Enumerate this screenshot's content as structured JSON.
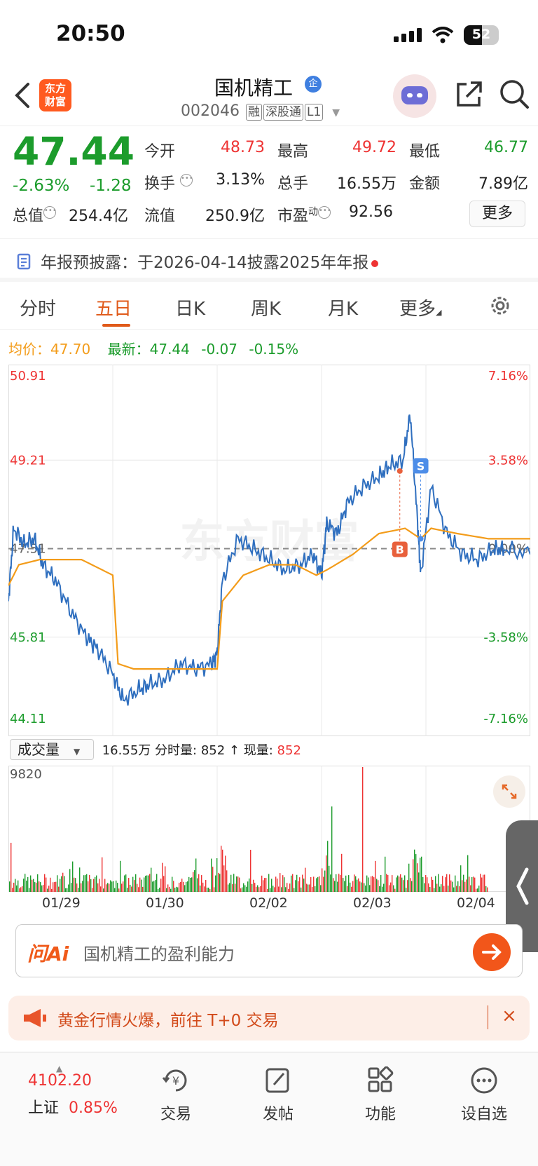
{
  "status": {
    "time": "20:50",
    "battery": "52"
  },
  "header": {
    "logo": "东方\n财富",
    "stock_name": "国机精工",
    "badge": "企",
    "code": "002046",
    "tags": [
      "融",
      "深股通",
      "L1"
    ]
  },
  "quote": {
    "price": "47.44",
    "change_pct": "-2.63%",
    "change": "-1.28",
    "open_label": "今开",
    "open": "48.73",
    "high_label": "最高",
    "high": "49.72",
    "low_label": "最低",
    "low": "46.77",
    "turnover_label": "换手",
    "turnover": "3.13%",
    "volume_label": "总手",
    "volume": "16.55万",
    "amount_label": "金额",
    "amount": "7.89亿",
    "mktcap_label": "总值",
    "mktcap": "254.4亿",
    "float_label": "流值",
    "float": "250.9亿",
    "pe_label": "市盈",
    "pe_sup": "动",
    "pe": "92.56",
    "more": "更多"
  },
  "notice": {
    "text": "年报预披露：于2026-04-14披露2025年年报"
  },
  "tabs": [
    "分时",
    "五日",
    "日K",
    "周K",
    "月K",
    "更多"
  ],
  "infobar": {
    "avg_label": "均价：",
    "avg": "47.70",
    "last_label": "最新：",
    "last": "47.44",
    "chg": "-0.07",
    "pct": "-0.15%"
  },
  "chart_data": {
    "type": "line",
    "title": "",
    "y_left_ticks": [
      "50.91",
      "49.21",
      "47.51",
      "45.81",
      "44.11"
    ],
    "y_right_ticks": [
      "7.16%",
      "3.58%",
      "0.00%",
      "-3.58%",
      "-7.16%"
    ],
    "ylim": [
      44.11,
      50.91
    ],
    "x_labels": [
      "01/29",
      "01/30",
      "02/02",
      "02/03",
      "02/04"
    ],
    "series": [
      {
        "name": "",
        "color": "#2f6fbf",
        "points": [
          [
            0,
            46.5
          ],
          [
            0.05,
            47.9
          ],
          [
            0.15,
            47.6
          ],
          [
            0.25,
            47.7
          ],
          [
            0.33,
            47.2
          ],
          [
            0.45,
            46.9
          ],
          [
            0.6,
            46.3
          ],
          [
            0.75,
            45.8
          ],
          [
            0.85,
            45.6
          ],
          [
            1.0,
            45.1
          ],
          [
            1.1,
            44.6
          ],
          [
            1.25,
            44.8
          ],
          [
            1.35,
            44.9
          ],
          [
            1.5,
            45.0
          ],
          [
            1.65,
            45.3
          ],
          [
            1.8,
            45.2
          ],
          [
            1.95,
            45.3
          ],
          [
            2.0,
            45.5
          ],
          [
            2.05,
            46.9
          ],
          [
            2.2,
            47.7
          ],
          [
            2.35,
            47.5
          ],
          [
            2.5,
            47.3
          ],
          [
            2.65,
            47.1
          ],
          [
            2.8,
            47.2
          ],
          [
            2.92,
            47.4
          ],
          [
            3.0,
            47.0
          ],
          [
            3.05,
            48.0
          ],
          [
            3.15,
            47.8
          ],
          [
            3.25,
            48.4
          ],
          [
            3.4,
            48.7
          ],
          [
            3.55,
            48.9
          ],
          [
            3.65,
            49.1
          ],
          [
            3.78,
            49.2
          ],
          [
            3.85,
            50.1
          ],
          [
            3.92,
            48.0
          ],
          [
            3.95,
            47.0
          ],
          [
            4.05,
            48.7
          ],
          [
            4.2,
            47.8
          ],
          [
            4.35,
            47.4
          ],
          [
            4.5,
            47.3
          ],
          [
            4.65,
            47.5
          ],
          [
            4.75,
            47.5
          ],
          [
            5.0,
            47.4
          ]
        ]
      },
      {
        "name": "",
        "color": "#f39c1a",
        "points": [
          [
            0,
            46.8
          ],
          [
            0.1,
            47.2
          ],
          [
            0.3,
            47.3
          ],
          [
            0.5,
            47.3
          ],
          [
            0.7,
            47.3
          ],
          [
            0.9,
            47.1
          ],
          [
            1.0,
            47.0
          ],
          [
            1.05,
            45.3
          ],
          [
            1.2,
            45.2
          ],
          [
            1.5,
            45.2
          ],
          [
            1.7,
            45.2
          ],
          [
            2.0,
            45.2
          ],
          [
            2.05,
            46.5
          ],
          [
            2.25,
            47.0
          ],
          [
            2.5,
            47.2
          ],
          [
            2.75,
            47.2
          ],
          [
            2.95,
            47.0
          ],
          [
            3.05,
            47.1
          ],
          [
            3.3,
            47.4
          ],
          [
            3.55,
            47.8
          ],
          [
            3.8,
            47.9
          ],
          [
            3.95,
            47.7
          ],
          [
            4.05,
            47.9
          ],
          [
            4.3,
            47.8
          ],
          [
            4.6,
            47.7
          ],
          [
            5.0,
            47.7
          ]
        ]
      }
    ],
    "markers": [
      {
        "label": "B",
        "color": "#e8603c"
      },
      {
        "label": "S",
        "color": "#4d8de8"
      }
    ],
    "watermark": "东方财富"
  },
  "volume": {
    "selector": "成交量",
    "total": "16.55万",
    "tick_label": "分时量:",
    "tick": "852",
    "arrow": "↑",
    "cur_label": "现量:",
    "cur": "852",
    "ymax": "9820"
  },
  "ask": {
    "logo": "问Ai",
    "placeholder": "国机精工的盈利能力"
  },
  "ad": {
    "text": "黄金行情火爆，前往 T+0 交易",
    "close": "×"
  },
  "bottom": {
    "index_value": "4102.20",
    "index_name": "上证",
    "index_pct": "0.85%",
    "nav": [
      "交易",
      "发帖",
      "功能",
      "设自选"
    ]
  }
}
